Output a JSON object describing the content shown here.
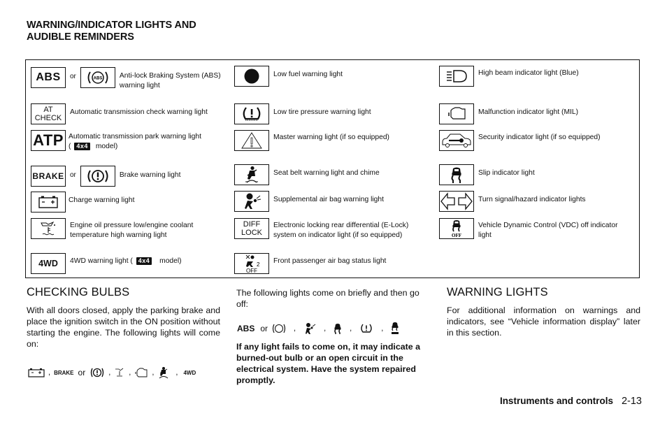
{
  "page": {
    "heading_line1": "WARNING/INDICATOR LIGHTS AND",
    "heading_line2": "AUDIBLE REMINDERS"
  },
  "legend": {
    "or_label": "or",
    "model_4x4_badge": "4x4",
    "items": {
      "abs": {
        "icon_text": "ABS",
        "alt_icon": "abs-circle-icon",
        "desc_line1": "Anti-lock Braking System (ABS)",
        "desc_line2": "warning light"
      },
      "at_check": {
        "icon_line1": "AT",
        "icon_line2": "CHECK",
        "desc": "Automatic transmission check warning light"
      },
      "atp": {
        "icon_text": "ATP",
        "desc_line1": "Automatic transmission park warning light",
        "desc_prefix": "(",
        "desc_suffix": "model)"
      },
      "brake": {
        "icon_text": "BRAKE",
        "alt_icon": "brake-circle-icon",
        "desc": "Brake warning light"
      },
      "charge": {
        "icon": "battery-icon",
        "desc": "Charge warning light"
      },
      "oil_temp": {
        "icon": "oil-coolant-icon",
        "desc_line1": "Engine oil pressure low/engine coolant",
        "desc_line2": "temperature high warning light"
      },
      "fourwd": {
        "icon_text": "4WD",
        "desc_prefix": "4WD warning light (",
        "desc_suffix": "model)"
      },
      "low_fuel": {
        "icon": "filled-circle-icon",
        "desc": "Low fuel warning light"
      },
      "tire": {
        "icon": "tire-pressure-icon",
        "desc": "Low tire pressure warning light"
      },
      "master": {
        "icon": "warning-triangle-icon",
        "desc": "Master warning light (if so equipped)"
      },
      "seatbelt": {
        "icon": "seatbelt-icon",
        "desc": "Seat belt warning light and chime"
      },
      "airbag": {
        "icon": "airbag-icon",
        "desc": "Supplemental air bag warning light"
      },
      "diff_lock": {
        "icon_line1": "DIFF",
        "icon_line2": "LOCK",
        "desc_line1": "Electronic locking rear differential (E-Lock)",
        "desc_line2": "system on indicator light (if so equipped)"
      },
      "passenger_airbag": {
        "icon_label": "OFF",
        "icon_num": "2",
        "desc": "Front passenger air bag status light"
      },
      "high_beam": {
        "icon": "high-beam-icon",
        "desc": "High beam indicator light (Blue)"
      },
      "mil": {
        "icon": "engine-icon",
        "desc": "Malfunction indicator light (MIL)"
      },
      "security": {
        "icon": "car-key-icon",
        "desc": "Security indicator light (if so equipped)"
      },
      "slip": {
        "icon": "slip-car-icon",
        "desc": "Slip indicator light"
      },
      "turn": {
        "icon": "turn-arrows-icon",
        "desc": "Turn signal/hazard indicator lights"
      },
      "vdc": {
        "icon_label": "OFF",
        "desc_line1": "Vehicle Dynamic Control (VDC) off indicator",
        "desc_line2": "light"
      }
    }
  },
  "checking_bulbs": {
    "title": "CHECKING BULBS",
    "body": "With all doors closed, apply the parking brake and place the ignition switch in the ON position without starting the engine. The following lights will come on:",
    "icons_row": {
      "brake_text": "BRAKE",
      "or_label": "or",
      "fourwd_text": "4WD",
      "sep": ","
    }
  },
  "brief_lights": {
    "body": "The following lights come on briefly and then go off:",
    "icons_row": {
      "abs_text": "ABS",
      "or_label": "or",
      "sep": ","
    },
    "warning": "If any light fails to come on, it may indicate a burned-out bulb or an open circuit in the electrical system. Have the system repaired promptly."
  },
  "warning_lights": {
    "title": "WARNING LIGHTS",
    "body": "For additional information on warnings and indicators, see “Vehicle information display” later in this section."
  },
  "footer": {
    "chapter": "Instruments and controls",
    "page_number": "2-13"
  }
}
